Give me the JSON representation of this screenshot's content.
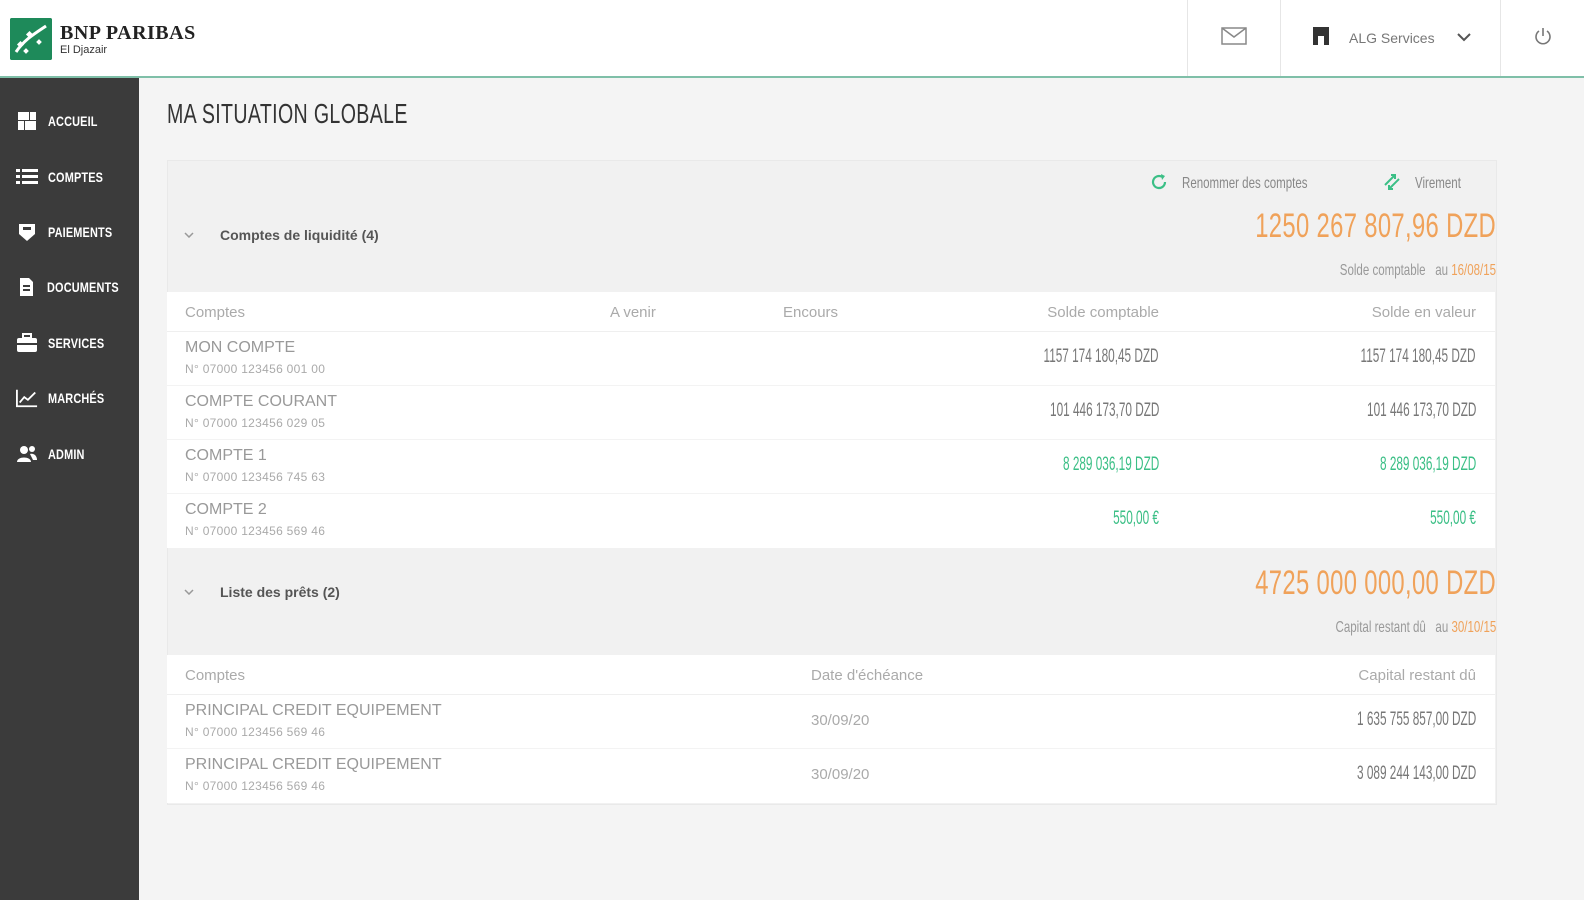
{
  "header": {
    "brand_name": "BNP PARIBAS",
    "brand_sub": "El Djazair",
    "user_name": "ALG Services"
  },
  "sidebar": {
    "items": [
      {
        "label": "ACCUEIL",
        "icon": "dashboard-icon"
      },
      {
        "label": "COMPTES",
        "icon": "list-icon"
      },
      {
        "label": "PAIEMENTS",
        "icon": "payment-icon"
      },
      {
        "label": "DOCUMENTS",
        "icon": "document-icon"
      },
      {
        "label": "SERVICES",
        "icon": "briefcase-icon"
      },
      {
        "label": "MARCHÉS",
        "icon": "chart-icon"
      },
      {
        "label": "ADMIN",
        "icon": "users-icon"
      }
    ]
  },
  "page": {
    "title": "MA SITUATION GLOBALE"
  },
  "toolbar": {
    "rename_label": "Renommer des comptes",
    "transfer_label": "Virement"
  },
  "liquidity": {
    "title": "Comptes de liquidité (4)",
    "total": "1250 267 807,96 DZD",
    "sub_label": "Solde comptable",
    "sub_prefix": "au",
    "sub_date": "16/08/15",
    "columns": [
      "Comptes",
      "A venir",
      "Encours",
      "Solde comptable",
      "Solde en valeur"
    ],
    "rows": [
      {
        "name": "MON COMPTE",
        "number": "N° 07000 123456 001 00",
        "solde_comptable": "1157 174 180,45 DZD",
        "solde_valeur": "1157 174 180,45 DZD",
        "highlight": false
      },
      {
        "name": "COMPTE COURANT",
        "number": "N° 07000 123456 029 05",
        "solde_comptable": "101 446 173,70 DZD",
        "solde_valeur": "101 446 173,70 DZD",
        "highlight": false
      },
      {
        "name": "COMPTE 1",
        "number": "N° 07000 123456 745 63",
        "solde_comptable": "8 289 036,19 DZD",
        "solde_valeur": "8 289 036,19 DZD",
        "highlight": true
      },
      {
        "name": "COMPTE 2",
        "number": "N° 07000 123456 569 46",
        "solde_comptable": "550,00 €",
        "solde_valeur": "550,00 €",
        "highlight": true
      }
    ]
  },
  "loans": {
    "title": "Liste des prêts (2)",
    "total": "4725 000 000,00 DZD",
    "sub_label": "Capital restant dû",
    "sub_prefix": "au",
    "sub_date": "30/10/15",
    "columns": [
      "Comptes",
      "Date d'échéance",
      "Capital restant dû"
    ],
    "rows": [
      {
        "name": "PRINCIPAL CREDIT EQUIPEMENT",
        "number": "N° 07000 123456 569 46",
        "date": "30/09/20",
        "capital": "1 635 755 857,00 DZD"
      },
      {
        "name": "PRINCIPAL CREDIT EQUIPEMENT",
        "number": "N° 07000 123456 569 46",
        "date": "30/09/20",
        "capital": "3 089 244 143,00 DZD"
      }
    ]
  },
  "colors": {
    "brand_green": "#1e8a5a",
    "sidebar_bg": "#3b3b3b",
    "amount_orange": "#f0a25a",
    "positive_green": "#3bbf86"
  }
}
